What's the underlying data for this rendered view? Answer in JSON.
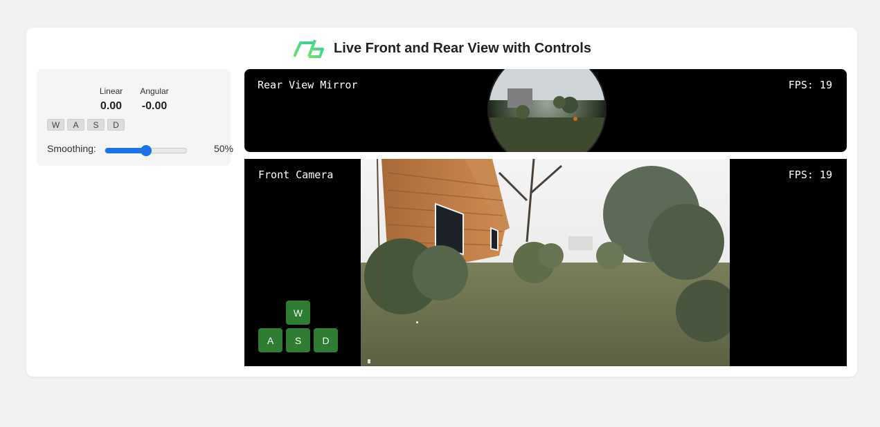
{
  "header": {
    "title": "Live Front and Rear View with Controls",
    "logo": "green-rb-logo"
  },
  "controls": {
    "linear_label": "Linear",
    "linear_value": "0.00",
    "angular_label": "Angular",
    "angular_value": "-0.00",
    "keys": [
      "W",
      "A",
      "S",
      "D"
    ],
    "smoothing_label": "Smoothing:",
    "smoothing_value": "50%",
    "smoothing_fraction": 0.5,
    "accent_color": "#1a73e8"
  },
  "rear_view": {
    "label": "Rear View Mirror",
    "fps": "FPS: 19"
  },
  "front_view": {
    "label": "Front Camera",
    "fps": "FPS: 19"
  },
  "wasd": {
    "w": "W",
    "a": "A",
    "s": "S",
    "d": "D",
    "color": "#2e7d32"
  }
}
